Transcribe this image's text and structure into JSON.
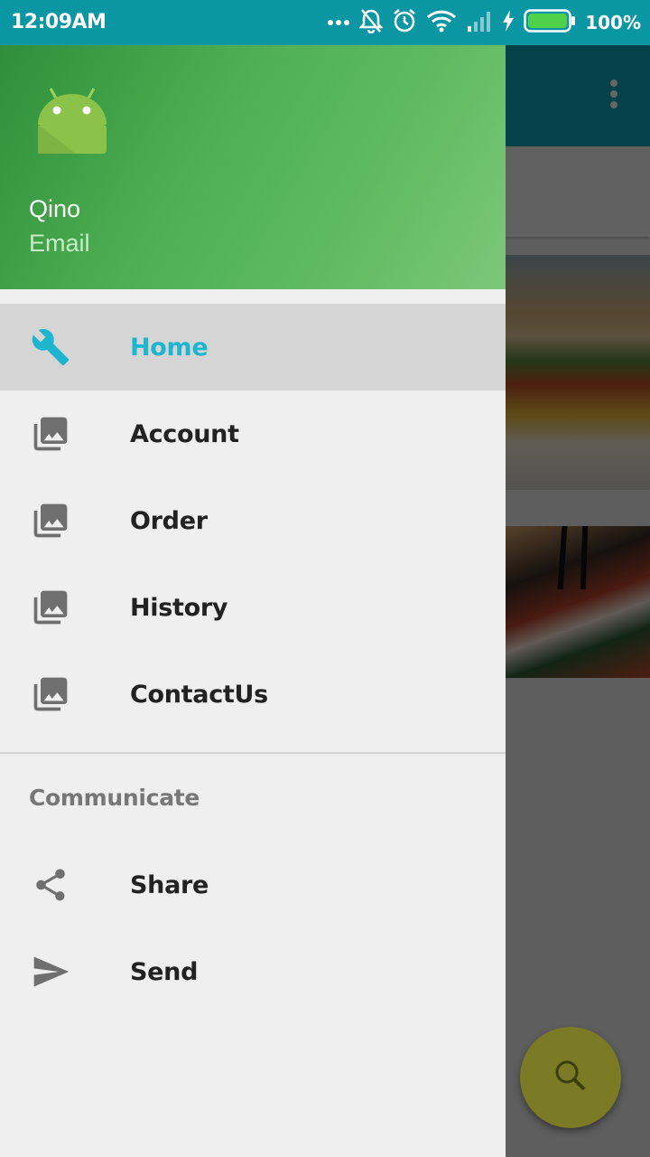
{
  "status_bar": {
    "time": "12:09AM",
    "battery": "100%",
    "icons": [
      "more-dots-icon",
      "bell-off-icon",
      "alarm-icon",
      "wifi-icon",
      "signal-icon",
      "charging-icon",
      "battery-icon"
    ]
  },
  "drawer": {
    "header": {
      "name": "Qino",
      "email": "Email"
    },
    "items": [
      {
        "label": "Home",
        "icon": "wrench-icon",
        "selected": true
      },
      {
        "label": "Account",
        "icon": "photo-library-icon"
      },
      {
        "label": "Order",
        "icon": "photo-library-icon"
      },
      {
        "label": "History",
        "icon": "photo-library-icon"
      },
      {
        "label": "ContactUs",
        "icon": "photo-library-icon"
      }
    ],
    "section_title": "Communicate",
    "section_items": [
      {
        "label": "Share",
        "icon": "share-icon"
      },
      {
        "label": "Send",
        "icon": "send-icon"
      }
    ]
  },
  "colors": {
    "status_bar": "#0a97a3",
    "toolbar": "#0aa3b3",
    "header_green": "#4eaf52",
    "selected_text": "#1eb5cf",
    "fab": "#7a7b24"
  }
}
